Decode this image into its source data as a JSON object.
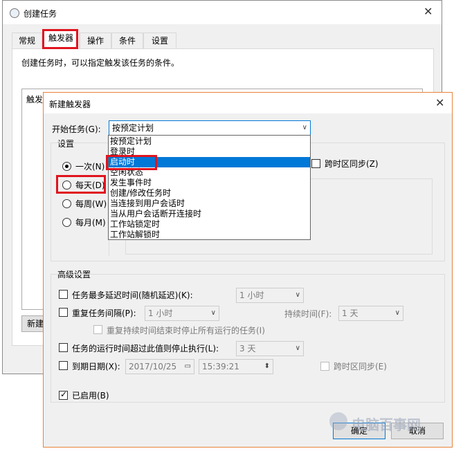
{
  "bg_window": {
    "title": "创建任务",
    "tabs": [
      "常规",
      "触发器",
      "操作",
      "条件",
      "设置"
    ],
    "description": "创建任务时，可以指定触发该任务的条件。",
    "list_header": "触发",
    "new_button": "新建"
  },
  "dialog": {
    "title": "新建触发器",
    "start_task_label": "开始任务(G):",
    "start_task_value": "按预定计划",
    "dropdown_options": [
      "按预定计划",
      "登录时",
      "启动时",
      "空闲状态",
      "发生事件时",
      "创建/修改任务时",
      "当连接到用户会话时",
      "当从用户会话断开连接时",
      "工作站锁定时",
      "工作站解锁时"
    ],
    "settings_label": "设置",
    "radios": [
      "一次(N)",
      "每天(D)",
      "每周(W)",
      "每月(M)"
    ],
    "sync_tz_label": "跨时区同步(Z)",
    "advanced_label": "高级设置",
    "delay_label": "任务最多延迟时间(随机延迟)(K):",
    "delay_value": "1 小时",
    "repeat_label": "重复任务间隔(P):",
    "repeat_value": "1 小时",
    "duration_label": "持续时间(F):",
    "duration_value": "1 天",
    "stop_all_label": "重复持续时间结束时停止所有运行的任务(I)",
    "stop_if_label": "任务的运行时间超过此值则停止执行(L):",
    "stop_if_value": "3 天",
    "expire_label": "到期日期(X):",
    "expire_date": "2017/10/25",
    "expire_time": "15:39:21",
    "expire_sync_label": "跨时区同步(E)",
    "enabled_label": "已启用(B)",
    "ok_label": "确定",
    "cancel_label": "取消"
  },
  "watermark": "电脑百事网",
  "colors": {
    "highlight": "#0078d7",
    "annotation": "#e0141e",
    "dialog_border": "#e8823a"
  }
}
